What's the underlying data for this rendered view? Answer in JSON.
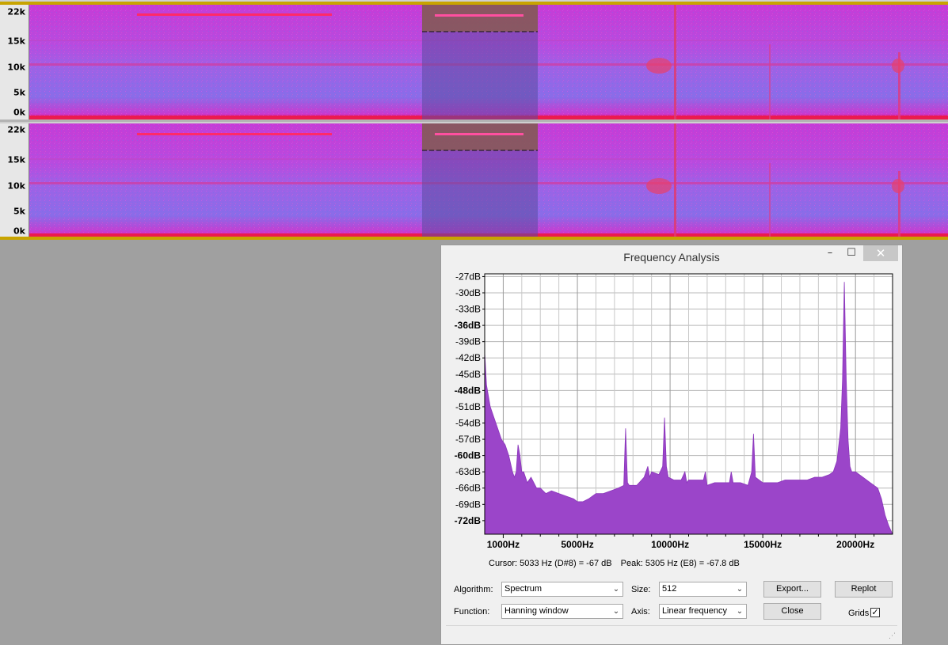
{
  "tracks": [
    {
      "id": "track-1",
      "ruler": [
        "22k",
        "15k",
        "10k",
        "5k",
        "0k"
      ]
    },
    {
      "id": "track-2",
      "ruler": [
        "22k",
        "15k",
        "10k",
        "5k",
        "0k"
      ]
    }
  ],
  "dialog": {
    "title": "Frequency Analysis",
    "min_glyph": "–",
    "max_glyph": "☐",
    "close_glyph": "✕",
    "cursor_readout": "Cursor: 5033 Hz (D#8) = -67 dB",
    "peak_readout": "Peak: 5305 Hz (E8) = -67.8 dB",
    "algorithm_label": "Algorithm:",
    "algorithm_value": "Spectrum",
    "function_label": "Function:",
    "function_value": "Hanning window",
    "size_label": "Size:",
    "size_value": "512",
    "axis_label": "Axis:",
    "axis_value": "Linear frequency",
    "export_label": "Export...",
    "replot_label": "Replot",
    "close_label": "Close",
    "grids_label": "Grids",
    "grids_checked": true,
    "chev": "⌄",
    "check": "✓"
  },
  "chart_data": {
    "type": "area",
    "title": "",
    "xlabel": "",
    "ylabel": "",
    "color": "#9b45c9",
    "xlim": [
      0,
      22000
    ],
    "ylim": [
      -74.5,
      -26.5
    ],
    "y_ticks": [
      "-27dB",
      "-30dB",
      "-33dB",
      "-36dB",
      "-39dB",
      "-42dB",
      "-45dB",
      "-48dB",
      "-51dB",
      "-54dB",
      "-57dB",
      "-60dB",
      "-63dB",
      "-66dB",
      "-69dB",
      "-72dB"
    ],
    "y_tick_values": [
      -27,
      -30,
      -33,
      -36,
      -39,
      -42,
      -45,
      -48,
      -51,
      -54,
      -57,
      -60,
      -63,
      -66,
      -69,
      -72
    ],
    "y_bold_values": [
      -36,
      -48,
      -60,
      -72
    ],
    "x_ticks": [
      "1000Hz",
      "5000Hz",
      "10000Hz",
      "15000Hz",
      "20000Hz"
    ],
    "x_tick_values": [
      1000,
      5000,
      10000,
      15000,
      20000
    ],
    "x": [
      0,
      100,
      300,
      500,
      700,
      900,
      1100,
      1300,
      1500,
      1600,
      1700,
      1800,
      1900,
      2000,
      2100,
      2300,
      2500,
      2800,
      3000,
      3300,
      3600,
      4000,
      4400,
      4800,
      5000,
      5300,
      5600,
      6000,
      6400,
      6800,
      7200,
      7500,
      7600,
      7700,
      7800,
      8200,
      8600,
      8800,
      8900,
      9000,
      9400,
      9600,
      9700,
      9800,
      9900,
      10200,
      10600,
      10800,
      10900,
      11000,
      11400,
      11800,
      11900,
      12000,
      12400,
      12800,
      13200,
      13300,
      13400,
      13800,
      14200,
      14400,
      14500,
      14600,
      15000,
      15400,
      15800,
      16200,
      16600,
      17000,
      17400,
      17800,
      18200,
      18600,
      18800,
      19000,
      19200,
      19300,
      19400,
      19500,
      19600,
      19700,
      19800,
      20000,
      20400,
      20800,
      21200,
      21400,
      21600,
      21800,
      22000
    ],
    "values": [
      -41,
      -47,
      -51,
      -53,
      -55,
      -57,
      -58,
      -60,
      -63,
      -64,
      -63,
      -58,
      -60,
      -63,
      -63,
      -65,
      -64,
      -66,
      -66,
      -67,
      -66.5,
      -67,
      -67.5,
      -68,
      -68.5,
      -68.5,
      -68,
      -67,
      -67,
      -66.5,
      -66,
      -65.5,
      -55,
      -65,
      -65.5,
      -65.5,
      -64,
      -62,
      -64,
      -63,
      -63.5,
      -62,
      -53,
      -62,
      -64,
      -64.5,
      -64.5,
      -63,
      -65,
      -64.5,
      -64.5,
      -64.5,
      -63,
      -65.5,
      -65,
      -65,
      -65,
      -63,
      -65,
      -65,
      -65.5,
      -63,
      -56,
      -64,
      -65,
      -65,
      -65,
      -64.5,
      -64.5,
      -64.5,
      -64.5,
      -64,
      -64,
      -63.5,
      -63,
      -61,
      -55,
      -46,
      -28,
      -46,
      -57,
      -62,
      -63,
      -63,
      -64,
      -65,
      -66,
      -68,
      -71,
      -73,
      -74.5
    ]
  }
}
